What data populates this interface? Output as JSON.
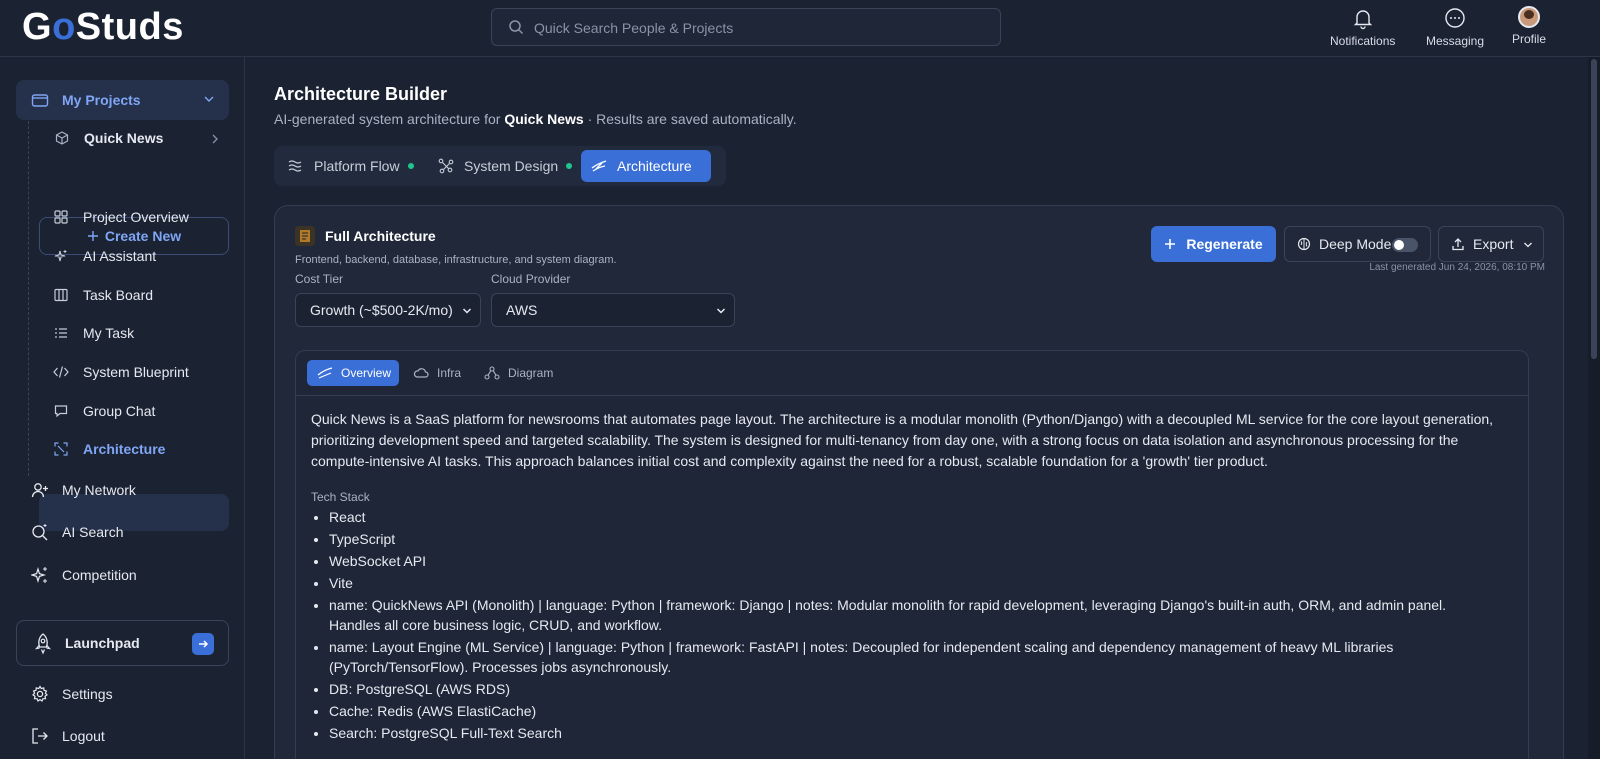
{
  "app": {
    "logo_prefix": "G",
    "logo_o": "o",
    "logo_suffix": "Studs"
  },
  "search": {
    "placeholder": "Quick Search People & Projects"
  },
  "topnav": {
    "notifications": "Notifications",
    "messaging": "Messaging",
    "profile": "Profile"
  },
  "sidebar": {
    "my_projects": "My Projects",
    "quick_news": "Quick News",
    "create_new": "Create New",
    "items": [
      "Project Overview",
      "AI Assistant",
      "Task Board",
      "My Task",
      "System Blueprint",
      "Group Chat",
      "Architecture"
    ],
    "my_network": "My Network",
    "ai_search": "AI Search",
    "competition": "Competition",
    "launchpad": "Launchpad",
    "settings": "Settings",
    "logout": "Logout"
  },
  "page": {
    "title": "Architecture Builder",
    "subtitle_pre": "AI-generated system architecture for ",
    "subtitle_project": "Quick News",
    "subtitle_post": " · Results are saved automatically."
  },
  "tabs": {
    "platform_flow": "Platform Flow",
    "system_design": "System Design",
    "architecture": "Architecture"
  },
  "card": {
    "title": "Full Architecture",
    "description": "Frontend, backend, database, infrastructure, and system diagram.",
    "cost_tier_label": "Cost Tier",
    "cost_tier_value": "Growth (~$500-2K/mo)",
    "cloud_label": "Cloud Provider",
    "cloud_value": "AWS",
    "regenerate": "Regenerate",
    "deep_mode": "Deep Mode",
    "export": "Export",
    "last_generated": "Last generated Jun 24, 2026, 08:10 PM"
  },
  "inner_tabs": {
    "overview": "Overview",
    "infra": "Infra",
    "diagram": "Diagram"
  },
  "overview_text": "Quick News is a SaaS platform for newsrooms that automates page layout. The architecture is a modular monolith (Python/Django) with a decoupled ML service for the core layout generation, prioritizing development speed and targeted scalability. The system is designed for multi-tenancy from day one, with a strong focus on data isolation and asynchronous processing for the compute-intensive AI tasks. This approach balances initial cost and complexity against the need for a robust, scalable foundation for a 'growth' tier product.",
  "tech_stack_label": "Tech Stack",
  "tech_stack": [
    "React",
    "TypeScript",
    "WebSocket API",
    "Vite",
    "name: QuickNews API (Monolith) | language: Python | framework: Django | notes: Modular monolith for rapid development, leveraging Django's built-in auth, ORM, and admin panel. Handles all core business logic, CRUD, and workflow.",
    "name: Layout Engine (ML Service) | language: Python | framework: FastAPI | notes: Decoupled for independent scaling and dependency management of heavy ML libraries (PyTorch/TensorFlow). Processes jobs asynchronously.",
    "DB: PostgreSQL (AWS RDS)",
    "Cache: Redis (AWS ElastiCache)",
    "Search: PostgreSQL Full-Text Search"
  ],
  "colors": {
    "accent": "#3a6fd8",
    "status_dot": "#22c58b",
    "background": "#1b2232"
  }
}
